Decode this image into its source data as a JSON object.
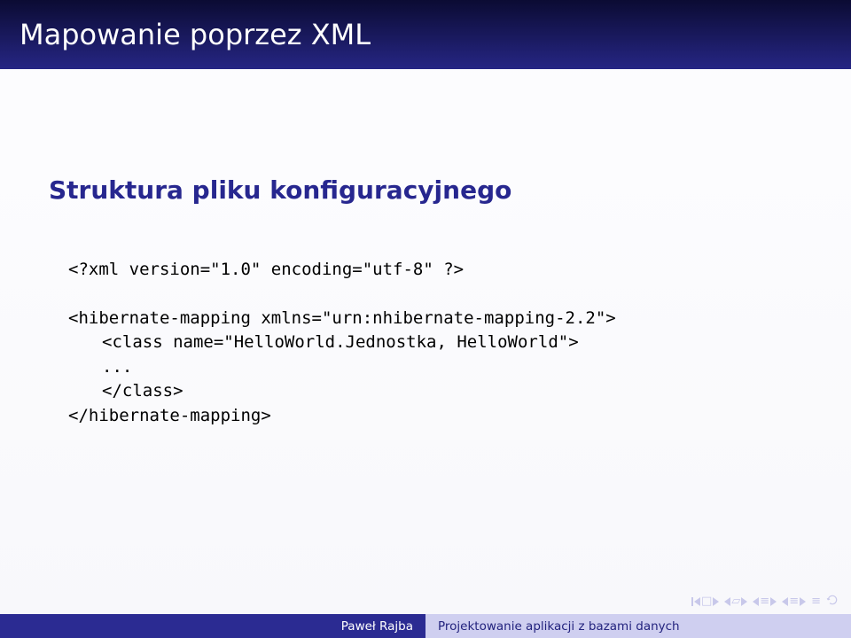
{
  "title": "Mapowanie poprzez XML",
  "subtitle": "Struktura pliku konfiguracyjnego",
  "code": {
    "l1": "<?xml version=\"1.0\" encoding=\"utf-8\" ?>",
    "l2": "<hibernate-mapping xmlns=\"urn:nhibernate-mapping-2.2\">",
    "l3": "<class name=\"HelloWorld.Jednostka, HelloWorld\">",
    "l4": "...",
    "l5": "</class>",
    "l6": "</hibernate-mapping>"
  },
  "footer": {
    "author": "Paweł Rajba",
    "topic": "Projektowanie aplikacji z bazami danych"
  }
}
